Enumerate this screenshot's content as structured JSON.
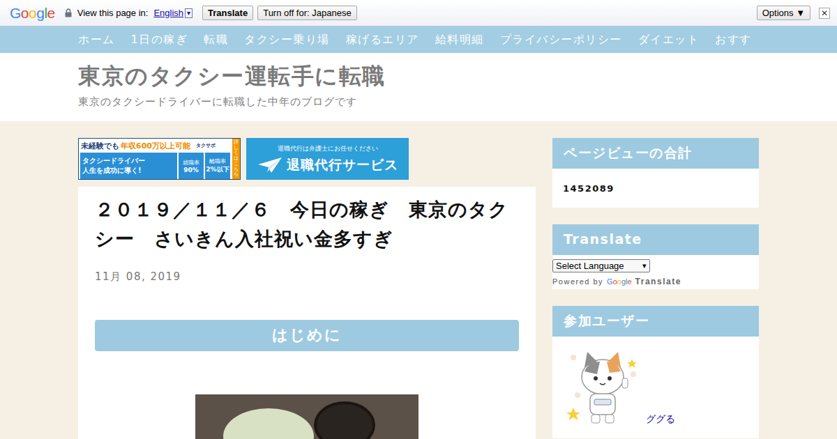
{
  "translate_bar": {
    "logo": [
      {
        "letter": "G",
        "color": "#4285f4"
      },
      {
        "letter": "o",
        "color": "#ea4335"
      },
      {
        "letter": "o",
        "color": "#fbbc05"
      },
      {
        "letter": "g",
        "color": "#4285f4"
      },
      {
        "letter": "l",
        "color": "#34a853"
      },
      {
        "letter": "e",
        "color": "#ea4335"
      }
    ],
    "prompt": "View this page in:",
    "language": "English",
    "dropdown": "▾",
    "translate_button": "Translate",
    "turn_off_button": "Turn off for: Japanese",
    "options_button": "Options ▼",
    "close": "✕"
  },
  "nav": {
    "items": [
      "ホーム",
      "1日の稼ぎ",
      "転職",
      "タクシー乗り場",
      "稼げるエリア",
      "給料明細",
      "プライバシーポリシー",
      "ダイエット",
      "おすす"
    ]
  },
  "header": {
    "title": "東京のタクシー運転手に転職",
    "subtitle": "東京のタクシードライバーに転職した中年のブログです"
  },
  "banners": {
    "recruit": {
      "headline_a": "未経験でも",
      "headline_b": "年収600万以上可能",
      "brand": "タクサポ",
      "slogan_a": "タクシードライバー",
      "slogan_b": "人生を成功に導く!",
      "stat_a_label": "就職率",
      "stat_a_value": "90%",
      "stat_b_label": "離職率",
      "stat_b_value": "2%以下",
      "cta": "詳しくはこちら"
    },
    "resign": {
      "tagline": "退職代行は弁護士にお任せください",
      "name": "退職代行サービス"
    }
  },
  "post": {
    "title": "２０１９／１１／６　今日の稼ぎ　東京のタクシー　さいきん入社祝い金多すぎ",
    "date": "11月 08, 2019",
    "heading": "はじめに"
  },
  "sidebar": {
    "pageviews": {
      "title": "ページビューの合計",
      "count": "1452089"
    },
    "translate": {
      "title": "Translate",
      "select": "Select Language",
      "arrow": "▾",
      "powered_by": "Powered by",
      "powered_logo": [
        {
          "letter": "G",
          "color": "#4285f4"
        },
        {
          "letter": "o",
          "color": "#ea4335"
        },
        {
          "letter": "o",
          "color": "#fbbc05"
        },
        {
          "letter": "g",
          "color": "#4285f4"
        },
        {
          "letter": "l",
          "color": "#34a853"
        },
        {
          "letter": "e",
          "color": "#ea4335"
        }
      ],
      "powered_name": "Translate"
    },
    "users": {
      "title": "参加ユーザー",
      "name": "ググる"
    }
  }
}
